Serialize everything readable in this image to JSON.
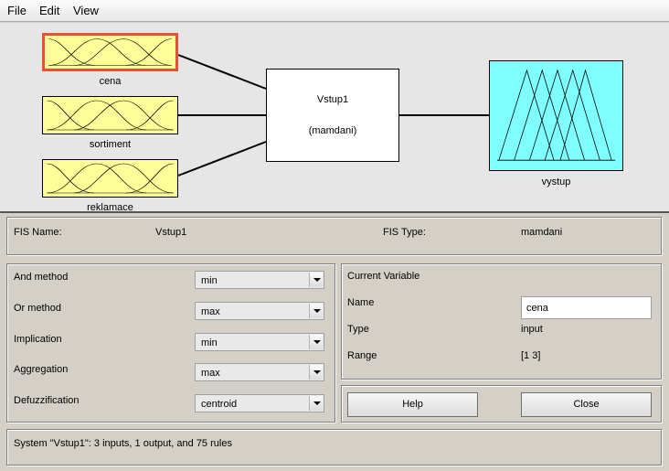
{
  "menu": {
    "file": "File",
    "edit": "Edit",
    "view": "View"
  },
  "diagram": {
    "inputs": [
      "cena",
      "sortiment",
      "reklamace"
    ],
    "fis_name": "Vstup1",
    "fis_type_display": "(mamdani)",
    "output": "vystup"
  },
  "fis_info": {
    "name_label": "FIS Name:",
    "name_value": "Vstup1",
    "type_label": "FIS Type:",
    "type_value": "mamdani"
  },
  "methods": {
    "and_label": "And method",
    "and_value": "min",
    "or_label": "Or method",
    "or_value": "max",
    "impl_label": "Implication",
    "impl_value": "min",
    "agg_label": "Aggregation",
    "agg_value": "max",
    "defuzz_label": "Defuzzification",
    "defuzz_value": "centroid"
  },
  "current_variable": {
    "title": "Current Variable",
    "name_label": "Name",
    "name_value": "cena",
    "type_label": "Type",
    "type_value": "input",
    "range_label": "Range",
    "range_value": "[1 3]"
  },
  "buttons": {
    "help": "Help",
    "close": "Close"
  },
  "status": "System \"Vstup1\": 3 inputs, 1 output, and 75 rules",
  "colors": {
    "input_mf_bg": "#ffff99",
    "output_mf_bg": "#80ffff",
    "selected_border": "#e8503a"
  }
}
